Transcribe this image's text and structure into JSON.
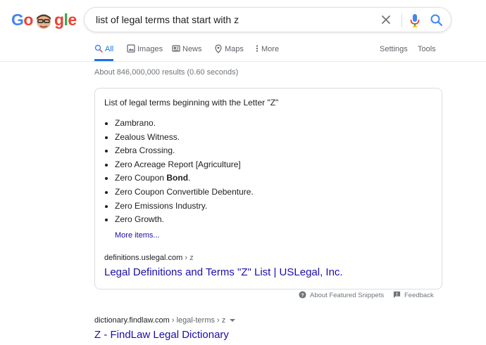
{
  "logo": {
    "text": "Google"
  },
  "search": {
    "query": "list of legal terms that start with z"
  },
  "tabs": [
    {
      "label": "All",
      "icon": "search-icon"
    },
    {
      "label": "Images",
      "icon": "image-icon"
    },
    {
      "label": "News",
      "icon": "news-icon"
    },
    {
      "label": "Maps",
      "icon": "map-pin-icon"
    },
    {
      "label": "More",
      "icon": "more-vert-icon"
    }
  ],
  "tools": {
    "settings": "Settings",
    "tools": "Tools"
  },
  "stats": "About 846,000,000 results (0.60 seconds)",
  "snippet": {
    "heading": "List of legal terms beginning with the Letter \"Z\"",
    "items": [
      "Zambrano.",
      "Zealous Witness.",
      "Zebra Crossing.",
      "Zero Acreage Report [Agriculture]",
      {
        "prefix": "Zero Coupon ",
        "bold": "Bond",
        "suffix": "."
      },
      "Zero Coupon Convertible Debenture.",
      "Zero Emissions Industry.",
      "Zero Growth."
    ],
    "more": "More items...",
    "source": {
      "domain": "definitions.uslegal.com",
      "path": " › z"
    },
    "title": "Legal Definitions and Terms \"Z\" List | USLegal, Inc."
  },
  "footer": {
    "about": "About Featured Snippets",
    "feedback": "Feedback"
  },
  "result2": {
    "domain": "dictionary.findlaw.com",
    "path": " › legal-terms › z",
    "title": "Z - FindLaw Legal Dictionary"
  },
  "colors": {
    "link": "#1a0dab",
    "accent": "#1a73e8",
    "muted": "#70757a"
  }
}
